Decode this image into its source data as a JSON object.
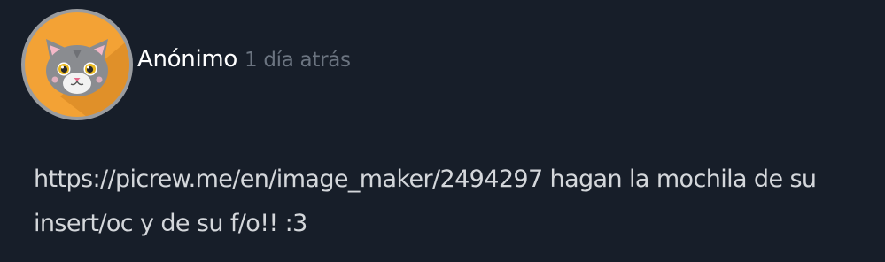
{
  "comment": {
    "author": "Anónimo",
    "timestamp": "1 día atrás",
    "avatar_icon": "gray-cat-avatar-icon",
    "link": "https://picrew.me/en/image_maker/2494297",
    "text_after_link": " hagan la mochila de su insert/oc y de su f/o!! :3"
  },
  "colors": {
    "background": "#171e29",
    "avatar_background": "#f3a235",
    "avatar_ring": "#9a9c9f",
    "author_text": "#ffffff",
    "timestamp_text": "#6b7480",
    "body_text": "#d4d7db"
  }
}
